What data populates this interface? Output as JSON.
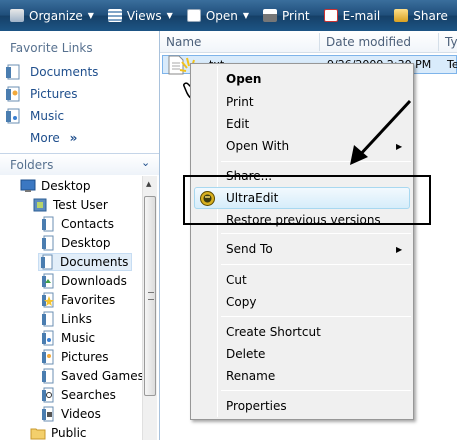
{
  "toolbar": {
    "organize": "Organize",
    "views": "Views",
    "open": "Open",
    "print": "Print",
    "email": "E-mail",
    "share": "Share"
  },
  "favorites": {
    "title": "Favorite Links",
    "items": [
      "Documents",
      "Pictures",
      "Music"
    ],
    "more": "More",
    "more_chevron": "»"
  },
  "folders": {
    "title": "Folders",
    "chevron": "⌄",
    "tree": [
      {
        "label": "Desktop",
        "icon": "desktop-icon"
      },
      {
        "label": "Test User",
        "icon": "user-folder-icon"
      },
      {
        "label": "Contacts",
        "icon": "contacts-folder-icon"
      },
      {
        "label": "Desktop",
        "icon": "desktop-folder-icon"
      },
      {
        "label": "Documents",
        "icon": "documents-folder-icon",
        "selected": true
      },
      {
        "label": "Downloads",
        "icon": "downloads-folder-icon"
      },
      {
        "label": "Favorites",
        "icon": "favorites-folder-icon"
      },
      {
        "label": "Links",
        "icon": "links-folder-icon"
      },
      {
        "label": "Music",
        "icon": "music-folder-icon"
      },
      {
        "label": "Pictures",
        "icon": "pictures-folder-icon"
      },
      {
        "label": "Saved Games",
        "icon": "saved-games-folder-icon"
      },
      {
        "label": "Searches",
        "icon": "searches-folder-icon"
      },
      {
        "label": "Videos",
        "icon": "videos-folder-icon"
      },
      {
        "label": "Public",
        "icon": "public-folder-icon"
      }
    ]
  },
  "columns": {
    "name": "Name",
    "date_modified": "Date modified",
    "type": "Ty"
  },
  "file": {
    "name": "txt",
    "date": "9/26/2009 2:30 PM",
    "type": "Te"
  },
  "context_menu": {
    "open": "Open",
    "print": "Print",
    "edit": "Edit",
    "open_with": "Open With",
    "share": "Share...",
    "ultraedit": "UltraEdit",
    "restore": "Restore previous versions",
    "send_to": "Send To",
    "cut": "Cut",
    "copy": "Copy",
    "create_shortcut": "Create Shortcut",
    "delete": "Delete",
    "rename": "Rename",
    "properties": "Properties",
    "submenu_arrow": "▶"
  },
  "colors": {
    "toolbar": "#1f4e7a",
    "link": "#1e4e8c",
    "menu_bg": "#f0f0f0",
    "highlight": "#d6edfa"
  }
}
